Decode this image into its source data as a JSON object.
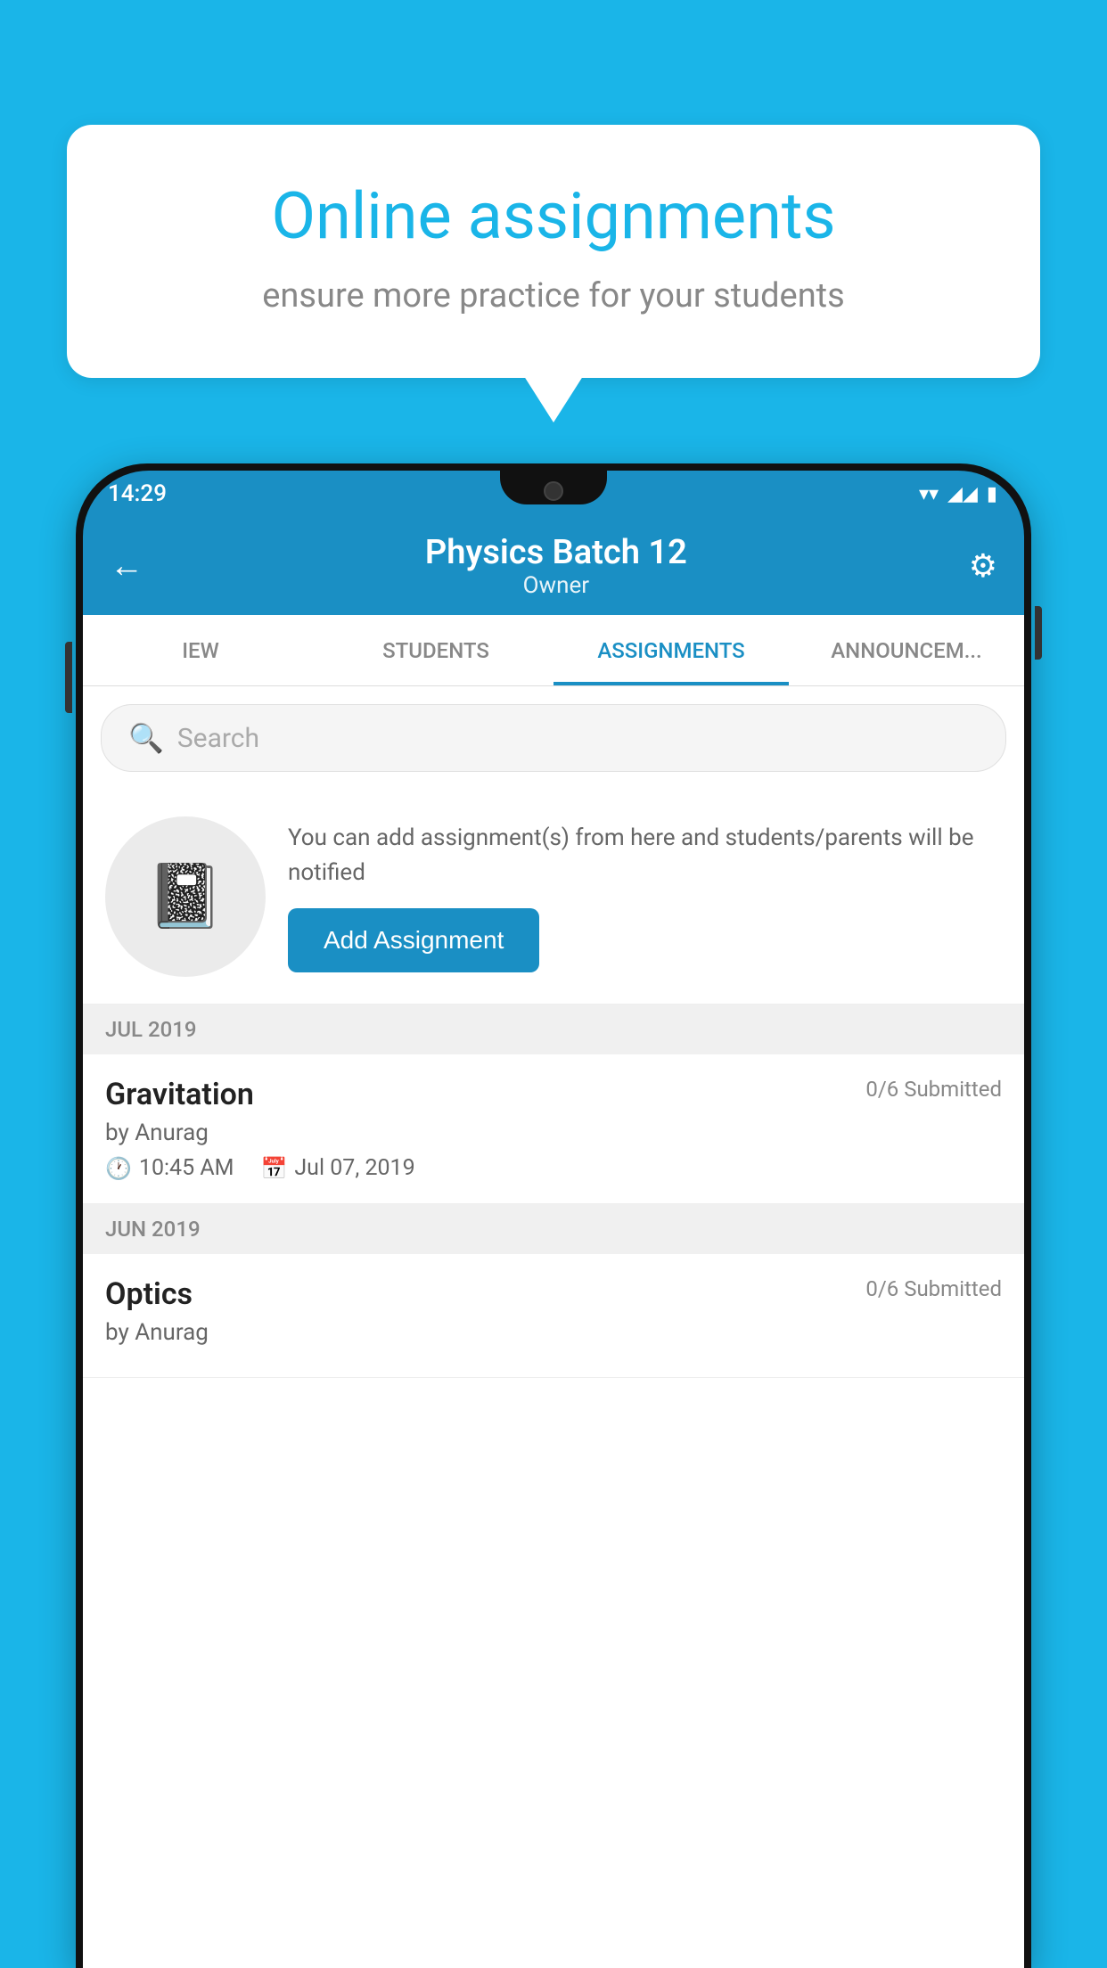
{
  "background_color": "#1ab5e8",
  "bubble": {
    "title": "Online assignments",
    "subtitle": "ensure more practice for your students"
  },
  "status_bar": {
    "time": "14:29",
    "wifi_icon": "▼",
    "signal_icon": "▲",
    "battery_icon": "▮"
  },
  "app_bar": {
    "title": "Physics Batch 12",
    "subtitle": "Owner",
    "back_label": "←",
    "settings_label": "⚙"
  },
  "tabs": [
    {
      "id": "overview",
      "label": "IEW",
      "active": false
    },
    {
      "id": "students",
      "label": "STUDENTS",
      "active": false
    },
    {
      "id": "assignments",
      "label": "ASSIGNMENTS",
      "active": true
    },
    {
      "id": "announcements",
      "label": "ANNOUNCEM...",
      "active": false
    }
  ],
  "search": {
    "placeholder": "Search"
  },
  "promo": {
    "text": "You can add assignment(s) from here and students/parents will be notified",
    "button_label": "Add Assignment"
  },
  "sections": [
    {
      "month": "JUL 2019",
      "assignments": [
        {
          "name": "Gravitation",
          "submitted": "0/6 Submitted",
          "by": "by Anurag",
          "time": "10:45 AM",
          "date": "Jul 07, 2019"
        }
      ]
    },
    {
      "month": "JUN 2019",
      "assignments": [
        {
          "name": "Optics",
          "submitted": "0/6 Submitted",
          "by": "by Anurag",
          "time": "",
          "date": ""
        }
      ]
    }
  ]
}
